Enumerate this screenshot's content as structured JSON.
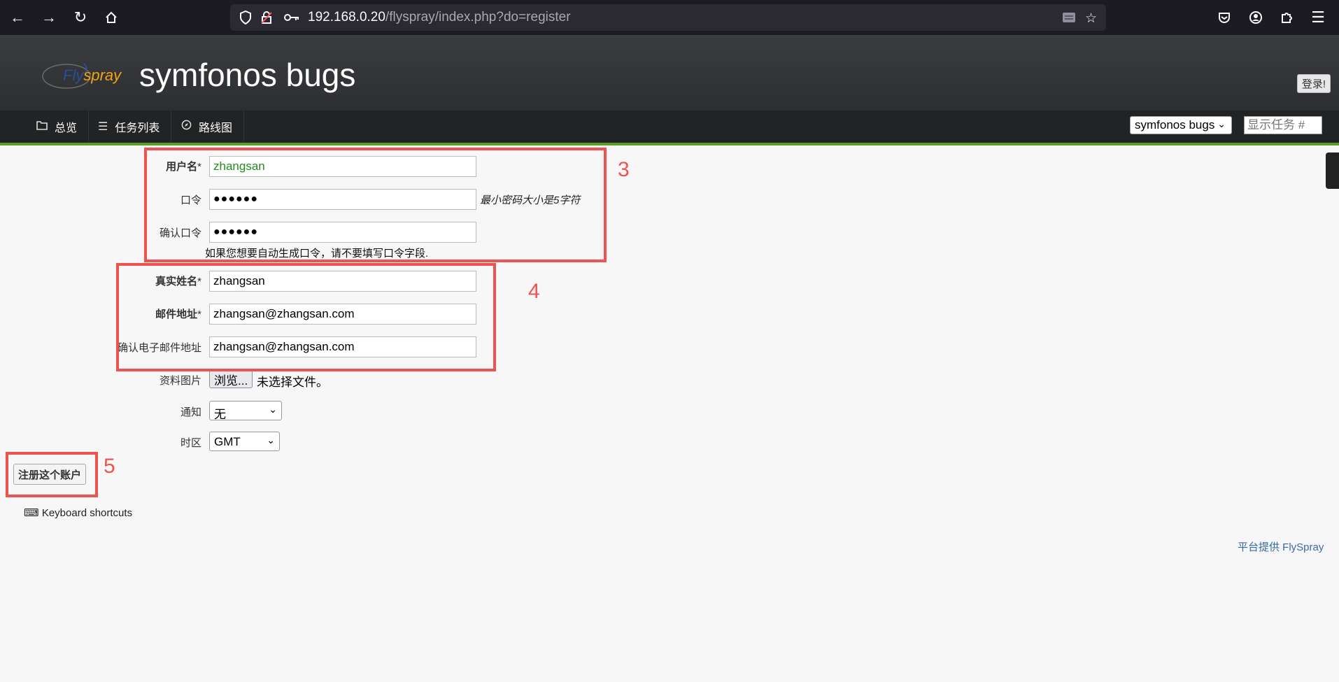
{
  "browser": {
    "url_host": "192.168.0.20",
    "url_path": "/flyspray/index.php?do=register"
  },
  "header": {
    "logo_fly": "Fly",
    "logo_spray": "spray",
    "title": "symfonos bugs",
    "login_label": "登录!"
  },
  "menu": {
    "items": [
      {
        "icon": "folder-icon",
        "label": "总览"
      },
      {
        "icon": "list-icon",
        "label": "任务列表"
      },
      {
        "icon": "compass-icon",
        "label": "路线图"
      }
    ],
    "project_select": "symfonos bugs",
    "task_search_placeholder": "显示任务 #"
  },
  "form": {
    "username_label": "用户名",
    "username_value": "zhangsan",
    "password_label": "口令",
    "password_value": "●●●●●●",
    "password_hint": "最小密码大小是5字符",
    "confirm_password_label": "确认口令",
    "confirm_password_value": "●●●●●●",
    "auto_password_note": "如果您想要自动生成口令，请不要填写口令字段.",
    "realname_label": "真实姓名",
    "realname_value": "zhangsan",
    "email_label": "邮件地址",
    "email_value": "zhangsan@zhangsan.com",
    "confirm_email_label": "确认电子邮件地址",
    "confirm_email_value": "zhangsan@zhangsan.com",
    "profile_image_label": "资料图片",
    "browse_label": "浏览...",
    "no_file_text": "未选择文件。",
    "notify_label": "通知",
    "notify_value": "无",
    "timezone_label": "时区",
    "timezone_value": "GMT",
    "required_mark": "*",
    "submit_label": "注册这个账户"
  },
  "footer": {
    "shortcuts_label": "Keyboard shortcuts",
    "powered_by": "平台提供 FlySpray"
  },
  "annotations": [
    "3",
    "4",
    "5"
  ],
  "colors": {
    "annotation": "#ef5350",
    "menu_accent": "#5aa028",
    "username_text": "#238a1e"
  }
}
